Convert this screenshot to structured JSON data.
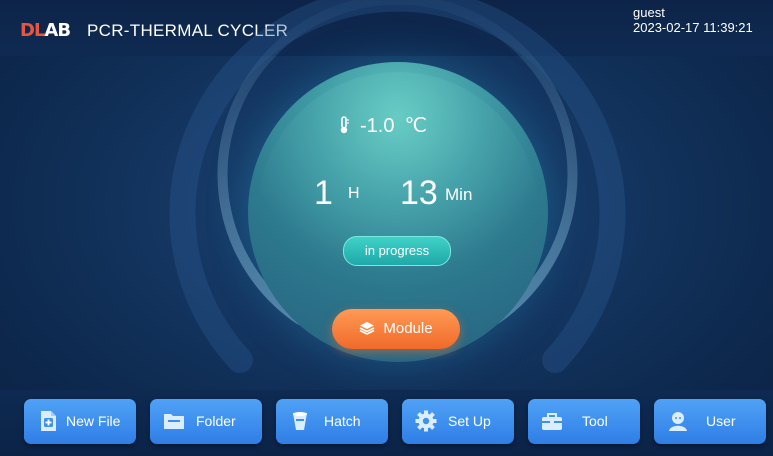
{
  "header": {
    "logo_text_red": "DL",
    "logo_text_white": "AB",
    "title": "PCR-THERMAL CYCLER",
    "user": "guest",
    "datetime": "2023-02-17 11:39:21"
  },
  "dial": {
    "temperature": "-1.0",
    "temperature_unit": "℃",
    "hours": "1",
    "hours_unit": "H",
    "minutes": "13",
    "minutes_unit": "Min",
    "status": "in progress"
  },
  "module_button": {
    "label": "Module",
    "icon": "layers-icon"
  },
  "nav": [
    {
      "label": "New File",
      "icon": "new-file-icon"
    },
    {
      "label": "Folder",
      "icon": "folder-icon"
    },
    {
      "label": "Hatch",
      "icon": "hatch-icon"
    },
    {
      "label": "Set Up",
      "icon": "gear-icon"
    },
    {
      "label": "Tool",
      "icon": "toolbox-icon"
    },
    {
      "label": "User",
      "icon": "user-icon"
    }
  ],
  "colors": {
    "accent_orange": "#f06a2a",
    "status_teal": "#1fa8a8",
    "nav_blue": "#2f7ee6",
    "background": "#153864"
  }
}
